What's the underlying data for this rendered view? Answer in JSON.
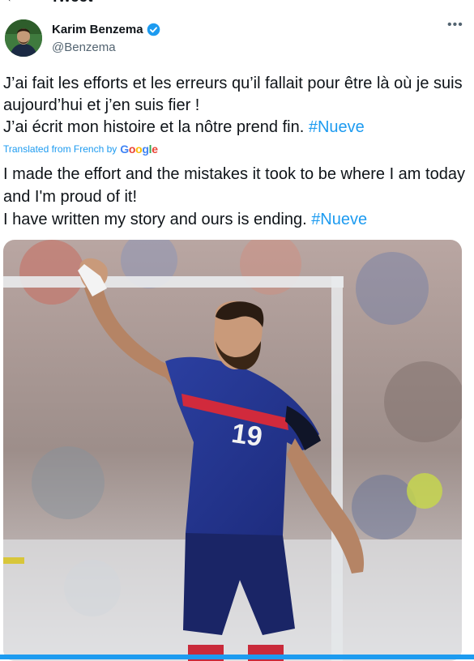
{
  "header": {
    "title": "Tweet",
    "back_icon": "arrow-left-icon"
  },
  "author": {
    "name": "Karim Benzema",
    "handle": "@Benzema",
    "verified": true,
    "verified_color": "#1d9bf0"
  },
  "tweet": {
    "lines": [
      "J’ai fait les efforts et les erreurs qu’il fallait pour être là où je suis aujourd’hui et j’en suis fier !",
      "J’ai écrit mon histoire et la nôtre prend fin."
    ],
    "hashtag": "#Nueve"
  },
  "translation": {
    "label": "Translated from French by",
    "provider": "Google",
    "lines": [
      "I made the effort and the mistakes it took to be where I am today and I'm proud of it!",
      "I have written my story and ours is ending."
    ],
    "hashtag": "#Nueve"
  },
  "media": {
    "jersey_number": "19"
  },
  "colors": {
    "accent": "#1d9bf0",
    "text": "#0f1419",
    "secondary": "#536471"
  }
}
